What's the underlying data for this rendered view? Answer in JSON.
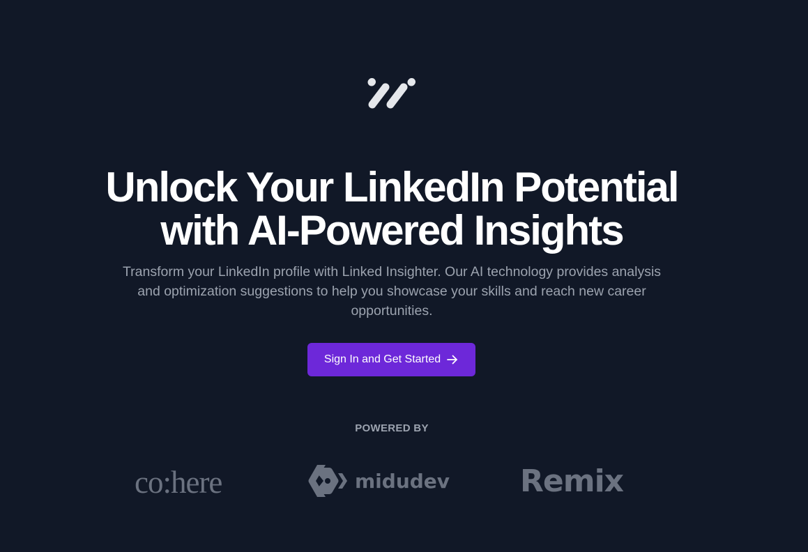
{
  "hero": {
    "logo_icon": "brand-slashes-icon",
    "title_line1": "Unlock Your LinkedIn Potential",
    "title_line2": "with AI-Powered Insights",
    "subtitle": "Transform your LinkedIn profile with Linked Insighter. Our AI technology provides analysis and optimization suggestions to help you showcase your skills and reach new career opportunities.",
    "cta_label": "Sign In and Get Started",
    "cta_icon": "arrow-right-icon"
  },
  "powered_by": {
    "label": "POWERED BY",
    "sponsors": [
      {
        "name": "co:here"
      },
      {
        "name": "midudev",
        "icon": "midudev-logo-icon"
      },
      {
        "name": "Remix"
      }
    ]
  },
  "colors": {
    "background": "#111827",
    "accent": "#6d28d9",
    "heading": "#ffffff",
    "muted": "#9ca3af",
    "sponsor": "#6b7280"
  }
}
